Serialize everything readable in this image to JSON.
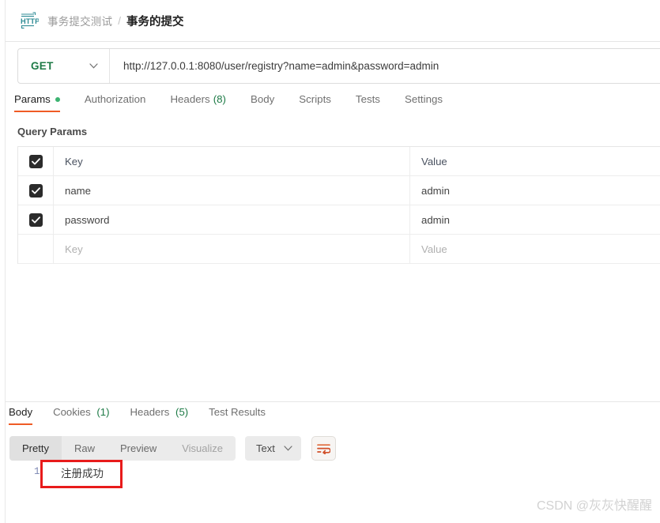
{
  "breadcrumb": {
    "icon": "http-protocol-icon",
    "collection": "事务提交测试",
    "separator": "/",
    "current": "事务的提交"
  },
  "url_bar": {
    "method": "GET",
    "method_chevron_icon": "chevron-down-icon",
    "url": "http://127.0.0.1:8080/user/registry?name=admin&password=admin"
  },
  "request_tabs": [
    {
      "label": "Params",
      "active": true,
      "dot": true
    },
    {
      "label": "Authorization",
      "active": false
    },
    {
      "label": "Headers",
      "count": "(8)",
      "active": false
    },
    {
      "label": "Body",
      "active": false
    },
    {
      "label": "Scripts",
      "active": false
    },
    {
      "label": "Tests",
      "active": false
    },
    {
      "label": "Settings",
      "active": false
    }
  ],
  "query_params": {
    "title": "Query Params",
    "columns": {
      "key": "Key",
      "value": "Value"
    },
    "rows": [
      {
        "checked": true,
        "key": "name",
        "value": "admin"
      },
      {
        "checked": true,
        "key": "password",
        "value": "admin"
      }
    ],
    "placeholder_row": {
      "key": "Key",
      "value": "Value"
    }
  },
  "response_tabs": [
    {
      "label": "Body",
      "active": true
    },
    {
      "label": "Cookies",
      "count": "(1)",
      "active": false
    },
    {
      "label": "Headers",
      "count": "(5)",
      "active": false
    },
    {
      "label": "Test Results",
      "active": false
    }
  ],
  "body_toolbar": {
    "views": [
      {
        "label": "Pretty",
        "active": true
      },
      {
        "label": "Raw",
        "active": false
      },
      {
        "label": "Preview",
        "active": false
      },
      {
        "label": "Visualize",
        "active": false,
        "dim": true
      }
    ],
    "format": {
      "label": "Text",
      "chevron_icon": "chevron-down-icon"
    },
    "wrap_button_icon": "wrap-lines-icon"
  },
  "response_body": {
    "line_number": "1",
    "text": "注册成功"
  },
  "watermark": "CSDN @灰灰快醒醒",
  "colors": {
    "accent_orange": "#ef5b25",
    "method_green": "#1d7a46",
    "count_green": "#1d7a46",
    "annotation_red": "#e81b1b",
    "http_icon_teal": "#2e8b94"
  }
}
